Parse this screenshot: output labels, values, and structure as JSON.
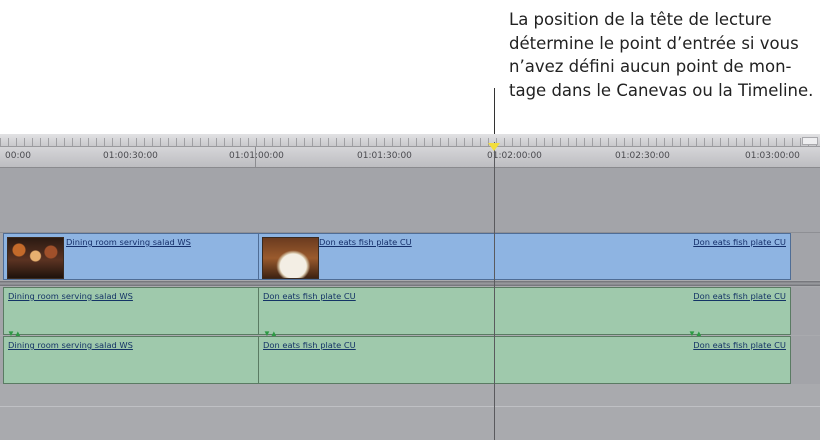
{
  "callout": {
    "lines": [
      "La position de la tête de lecture",
      "détermine le point d’entrée si vous",
      "n’avez défini aucun point de mon-",
      "tage dans le Canevas ou la Timeline."
    ]
  },
  "ruler": {
    "timecodes": [
      "00:00",
      "01:00:30:00",
      "01:01:00:00",
      "01:01:30:00",
      "01:02:00:00",
      "01:02:30:00",
      "01:03:00:00"
    ]
  },
  "tracks": {
    "video": [
      {
        "name": "Dining room serving salad WS",
        "thumbnail": "dining-room-thumbnail"
      },
      {
        "name": "Don eats fish plate CU",
        "thumbnail": "fish-plate-thumbnail"
      },
      {
        "name": "Don eats fish plate CU"
      }
    ],
    "audio1": [
      {
        "name": "Dining room serving salad WS"
      },
      {
        "name": "Don eats fish plate CU"
      },
      {
        "name": "Don eats fish plate CU"
      }
    ],
    "audio2": [
      {
        "name": "Dining room serving salad WS"
      },
      {
        "name": "Don eats fish plate CU"
      },
      {
        "name": "Don eats fish plate CU"
      }
    ]
  },
  "colors": {
    "video_clip": "#8eb4e2",
    "audio_clip": "#9fc9ac",
    "playhead_handle": "#f2dd3c",
    "sync_marker": "#2e9a45"
  },
  "icons": {
    "sync": "link-sync-icon",
    "playhead": "playhead-icon"
  }
}
